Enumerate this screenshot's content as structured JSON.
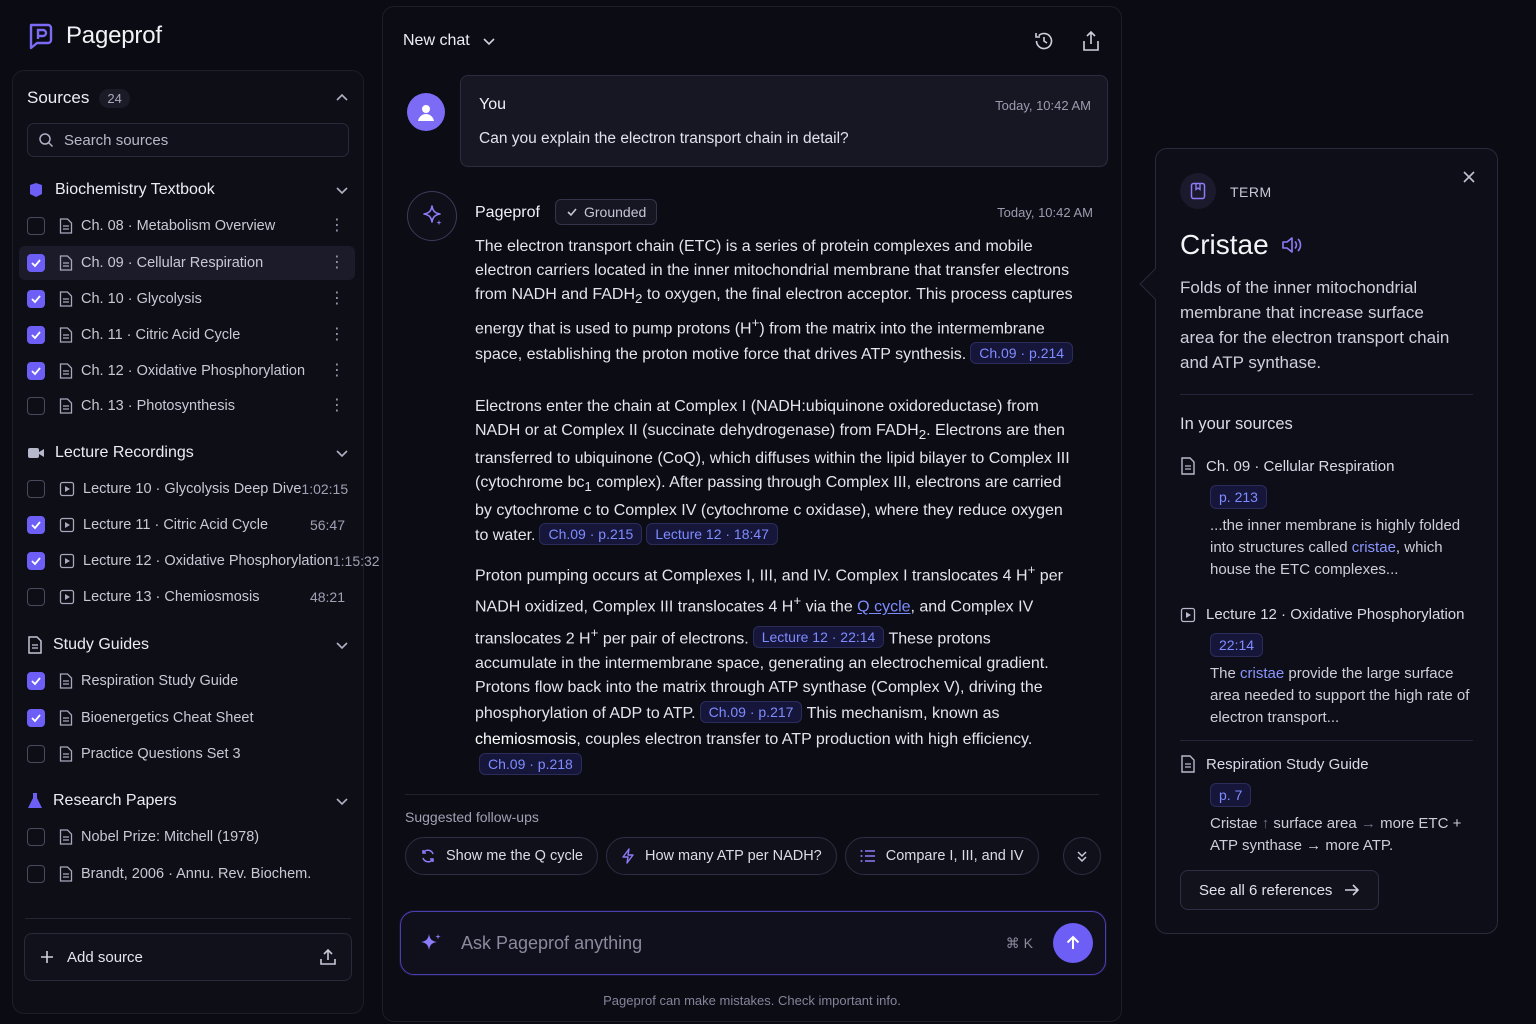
{
  "brand": {
    "name": "Pageprof"
  },
  "sources": {
    "title": "Sources",
    "count": "24",
    "search_placeholder": "Search sources",
    "groups": [
      {
        "label": "Biochemistry Textbook",
        "items": [
          {
            "label": "Ch. 08 · Metabolism Overview",
            "checked": false
          },
          {
            "label": "Ch. 09 · Cellular Respiration",
            "checked": true,
            "active": true
          },
          {
            "label": "Ch. 10 · Glycolysis",
            "checked": true
          },
          {
            "label": "Ch. 11 · Citric Acid Cycle",
            "checked": true
          },
          {
            "label": "Ch. 12 · Oxidative Phosphorylation",
            "checked": true
          },
          {
            "label": "Ch. 13 · Photosynthesis",
            "checked": false
          }
        ]
      },
      {
        "label": "Lecture Recordings",
        "items": [
          {
            "label": "Lecture 10 · Glycolysis Deep Dive",
            "duration": "1:02:15",
            "checked": false
          },
          {
            "label": "Lecture 11 · Citric Acid Cycle",
            "duration": "56:47",
            "checked": true
          },
          {
            "label": "Lecture 12 · Oxidative Phosphorylation",
            "duration": "1:15:32",
            "checked": true
          },
          {
            "label": "Lecture 13 · Chemiosmosis",
            "duration": "48:21",
            "checked": false
          }
        ]
      },
      {
        "label": "Study Guides",
        "items": [
          {
            "label": "Respiration Study Guide",
            "checked": true
          },
          {
            "label": "Bioenergetics Cheat Sheet",
            "checked": true
          },
          {
            "label": "Practice Questions Set 3",
            "checked": false
          }
        ]
      },
      {
        "label": "Research Papers",
        "items": [
          {
            "label": "Nobel Prize: Mitchell (1978)",
            "checked": false
          },
          {
            "label": "Brandt, 2006 · Annu. Rev. Biochem.",
            "checked": false
          }
        ]
      }
    ],
    "add_label": "Add source"
  },
  "chat": {
    "title": "New chat",
    "user": {
      "name": "You",
      "time": "Today, 10:42 AM",
      "text": "Can you explain the electron transport chain in detail?"
    },
    "bot": {
      "name": "Pageprof",
      "badge": "Grounded",
      "time": "Today, 10:42 AM",
      "p1": {
        "t1": "The electron transport chain (ETC) is a series of protein complexes and mobile electron carriers located in the inner mitochondrial membrane that transfer electrons from NADH and FADH",
        "sub1": "2",
        "t2": " to oxygen, the final electron acceptor. This process captures energy that is used to pump protons (H",
        "sup1": "+",
        "t3": ") from the matrix into the intermembrane space, establishing the proton motive force that drives ATP synthesis.",
        "cite1": "Ch.09 · p.214"
      },
      "p2": {
        "t1": "Electrons enter the chain at Complex I (NADH:ubiquinone oxidoreductase) from NADH or at Complex II (succinate dehydrogenase) from FADH",
        "sub1": "2",
        "t2": ". Electrons are then transferred to ubiquinone (CoQ), which diffuses within the lipid bilayer to Complex III (cytochrome bc",
        "sub2": "1",
        "t3": " complex). After passing through Complex III, electrons are carried by cytochrome c to Complex IV (cytochrome c oxidase), where they reduce oxygen to water.",
        "cite1": "Ch.09 · p.215",
        "cite2": "Lecture 12 · 18:47"
      },
      "p3": {
        "t1": "Proton pumping occurs at Complexes I, III, and IV. Complex I translocates 4 H",
        "sup1": "+",
        "t2": " per NADH oxidized, Complex III translocates 4 H",
        "sup2": "+",
        "t3": " via the ",
        "link": "Q cycle",
        "t4": ", and Complex IV translocates 2 H",
        "sup3": "+",
        "t5": " per pair of electrons.",
        "cite1": "Lecture 12 · 22:14",
        "t6": " These protons accumulate in the intermembrane space, generating an electrochemical gradient."
      },
      "p4": {
        "t1": "Protons flow back into the matrix through ATP synthase (Complex V), driving the phosphorylation of ADP to ATP.",
        "cite1": "Ch.09 · p.217",
        "t2": " This mechanism, known as ",
        "bold": "chemiosmosis",
        "t3": ", couples electron transfer to ATP production with high efficiency.",
        "cite2": "Ch.09 · p.218"
      }
    },
    "suggested_label": "Suggested follow-ups",
    "chips": [
      "Show me the Q cycle",
      "How many ATP per NADH?",
      "Compare I, III, and IV"
    ],
    "composer_placeholder": "Ask Pageprof anything",
    "shortcut": "⌘ K",
    "disclaimer": "Pageprof can make mistakes. Check important info."
  },
  "term": {
    "type": "TERM",
    "title": "Cristae",
    "definition": "Folds of the inner mitochondrial membrane that increase surface area for the electron transport chain and ATP synthase.",
    "sources_label": "In your sources",
    "refs": [
      {
        "source": "Ch. 09 · Cellular Respiration",
        "page": "p. 213",
        "t1": "...the inner membrane is highly folded into structures called ",
        "hl": "cristae",
        "t2": ", which house the ETC complexes..."
      },
      {
        "source": "Lecture 12 · Oxidative Phosphorylation",
        "page": "22:14",
        "t1": "The ",
        "hl": "cristae",
        "t2": " provide the large surface area needed to support the high rate of electron transport..."
      },
      {
        "source": "Respiration Study Guide",
        "page": "p. 7",
        "t1": "Cristae ",
        "a1": "↑",
        "t2": " surface area ",
        "a2": "→",
        "t3": " more ETC + ATP synthase ",
        "a3": "→",
        "t4": " more ATP."
      }
    ],
    "see_all": "See all 6 references"
  },
  "colors": {
    "accent": "#6d5ef5",
    "link": "#7f8cff"
  }
}
